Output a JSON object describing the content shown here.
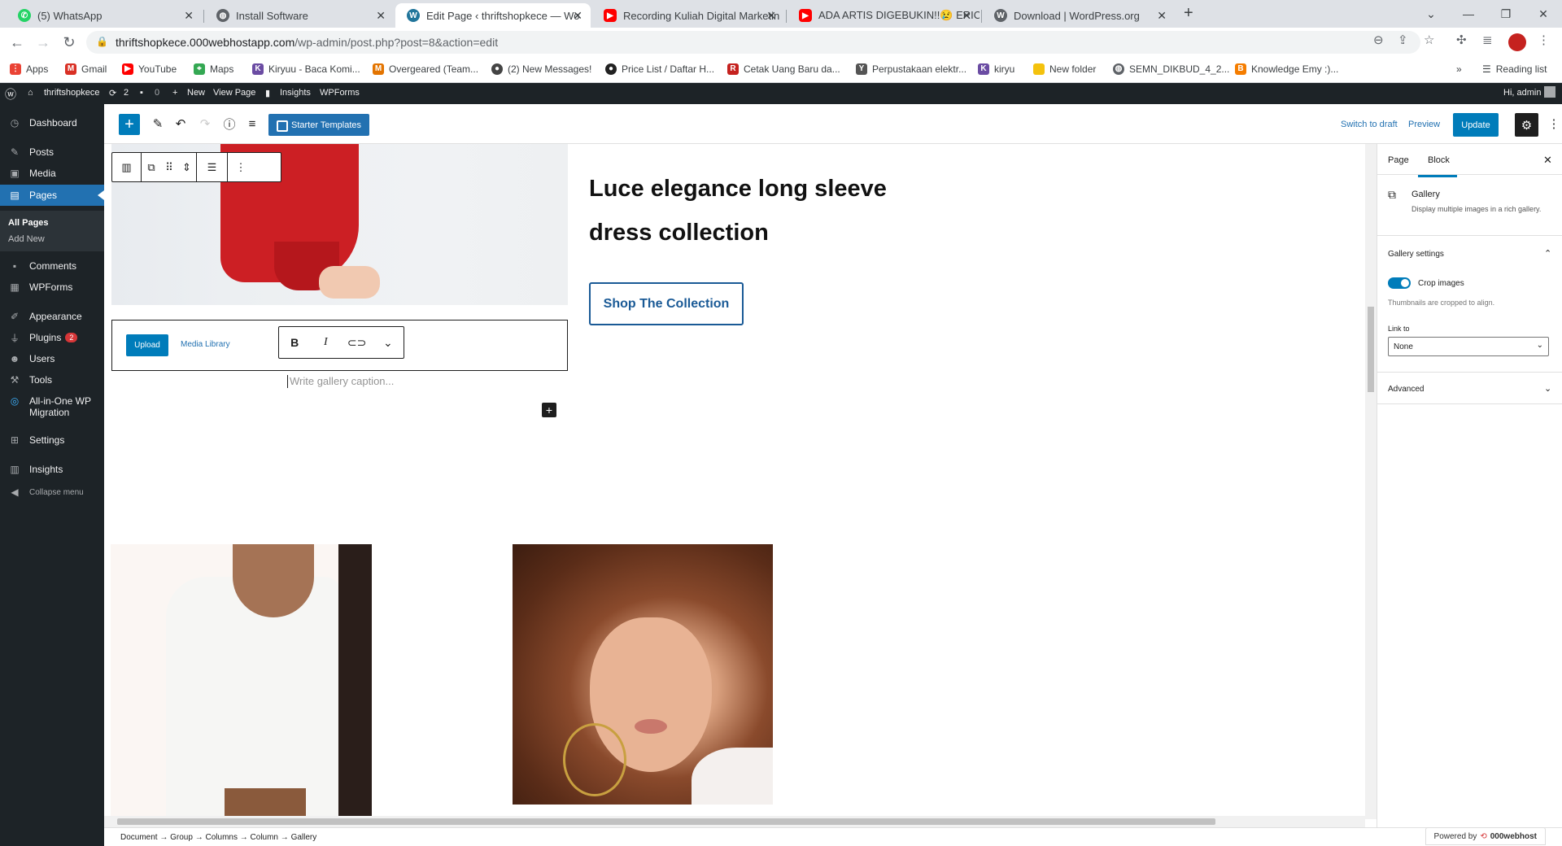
{
  "browser": {
    "tabs": [
      {
        "title": "(5) WhatsApp",
        "favicon": "whatsapp-icon",
        "color": "#25d366"
      },
      {
        "title": "Install Software",
        "favicon": "globe-icon",
        "color": "#5f6368"
      },
      {
        "title": "Edit Page ‹ thriftshopkece — Wo",
        "favicon": "wordpress-icon",
        "color": "#21759b"
      },
      {
        "title": "Recording Kuliah Digital Marketin",
        "favicon": "youtube-icon",
        "color": "#ff0000"
      },
      {
        "title": "ADA ARTIS DIGEBUKIN!!😢 ERICK",
        "favicon": "youtube-icon",
        "color": "#ff0000"
      },
      {
        "title": "Download | WordPress.org",
        "favicon": "wordpress-icon",
        "color": "#5f6368"
      }
    ],
    "new_tab": "+",
    "url_host": "thriftshopkece.000webhostapp.com",
    "url_path": "/wp-admin/post.php?post=8&action=edit",
    "bookmarks": [
      {
        "label": "Apps",
        "icon": "apps-grid-icon",
        "color": "#ea4335"
      },
      {
        "label": "Gmail",
        "icon": "gmail-icon",
        "color": "#d93025"
      },
      {
        "label": "YouTube",
        "icon": "youtube-icon",
        "color": "#ff0000"
      },
      {
        "label": "Maps",
        "icon": "maps-icon",
        "color": "#34a853"
      },
      {
        "label": "Kiryuu - Baca Komi...",
        "icon": "kiryuu-icon",
        "color": "#6b4ca3"
      },
      {
        "label": "Overgeared (Team...",
        "icon": "overgeared-icon",
        "color": "#e37400"
      },
      {
        "label": "(2) New Messages!",
        "icon": "messages-icon",
        "color": "#444444"
      },
      {
        "label": "Price List / Daftar H...",
        "icon": "pricelist-icon",
        "color": "#222222"
      },
      {
        "label": "Cetak Uang Baru da...",
        "icon": "cetak-icon",
        "color": "#c5221f"
      },
      {
        "label": "Perpustakaan elektr...",
        "icon": "library-icon",
        "color": "#555555"
      },
      {
        "label": "kiryu",
        "icon": "kiryuu-icon",
        "color": "#6b4ca3"
      },
      {
        "label": "New folder",
        "icon": "folder-icon",
        "color": "#f4c20d"
      },
      {
        "label": "SEMN_DIKBUD_4_2...",
        "icon": "globe-icon",
        "color": "#5f6368"
      },
      {
        "label": "Knowledge Emy :)...",
        "icon": "blogger-icon",
        "color": "#f57d00"
      }
    ],
    "reading_list": "Reading list"
  },
  "adminbar": {
    "site": "thriftshopkece",
    "updates": "2",
    "comments": "0",
    "new": "New",
    "view_page": "View Page",
    "insights": "Insights",
    "wpforms": "WPForms",
    "greeting": "Hi, admin"
  },
  "sidebar": {
    "items": [
      {
        "label": "Dashboard",
        "icon": "dashboard-icon"
      },
      {
        "label": "Posts",
        "icon": "pin-icon"
      },
      {
        "label": "Media",
        "icon": "media-icon"
      },
      {
        "label": "Pages",
        "icon": "pages-icon"
      },
      {
        "label": "Comments",
        "icon": "comment-icon"
      },
      {
        "label": "WPForms",
        "icon": "form-icon"
      },
      {
        "label": "Appearance",
        "icon": "brush-icon"
      },
      {
        "label": "Plugins",
        "icon": "plugin-icon",
        "badge": "2"
      },
      {
        "label": "Users",
        "icon": "users-icon"
      },
      {
        "label": "Tools",
        "icon": "wrench-icon"
      },
      {
        "label": "All-in-One WP Migration",
        "icon": "migration-icon"
      },
      {
        "label": "Settings",
        "icon": "settings-icon"
      },
      {
        "label": "Insights",
        "icon": "insights-icon"
      },
      {
        "label": "Collapse menu",
        "icon": "collapse-icon"
      }
    ],
    "submenu": [
      "All Pages",
      "Add New"
    ]
  },
  "editor": {
    "starter_templates": "Starter Templates",
    "switch_to_draft": "Switch to draft",
    "preview": "Preview",
    "update": "Update"
  },
  "canvas": {
    "heading": "Luce elegance long sleeve dress collection",
    "shop_button": "Shop The Collection",
    "upload": "Upload",
    "media_library": "Media Library",
    "caption_placeholder": "Write gallery caption..."
  },
  "panel": {
    "tab_page": "Page",
    "tab_block": "Block",
    "block_name": "Gallery",
    "block_desc": "Display multiple images in a rich gallery.",
    "gallery_settings": "Gallery settings",
    "crop_label": "Crop images",
    "crop_help": "Thumbnails are cropped to align.",
    "crop_enabled": true,
    "link_to_label": "Link to",
    "link_to_value": "None",
    "advanced": "Advanced"
  },
  "footer": {
    "breadcrumb": [
      "Document",
      "Group",
      "Columns",
      "Column",
      "Gallery"
    ],
    "powered": "Powered by",
    "powered_brand": "000webhost"
  }
}
